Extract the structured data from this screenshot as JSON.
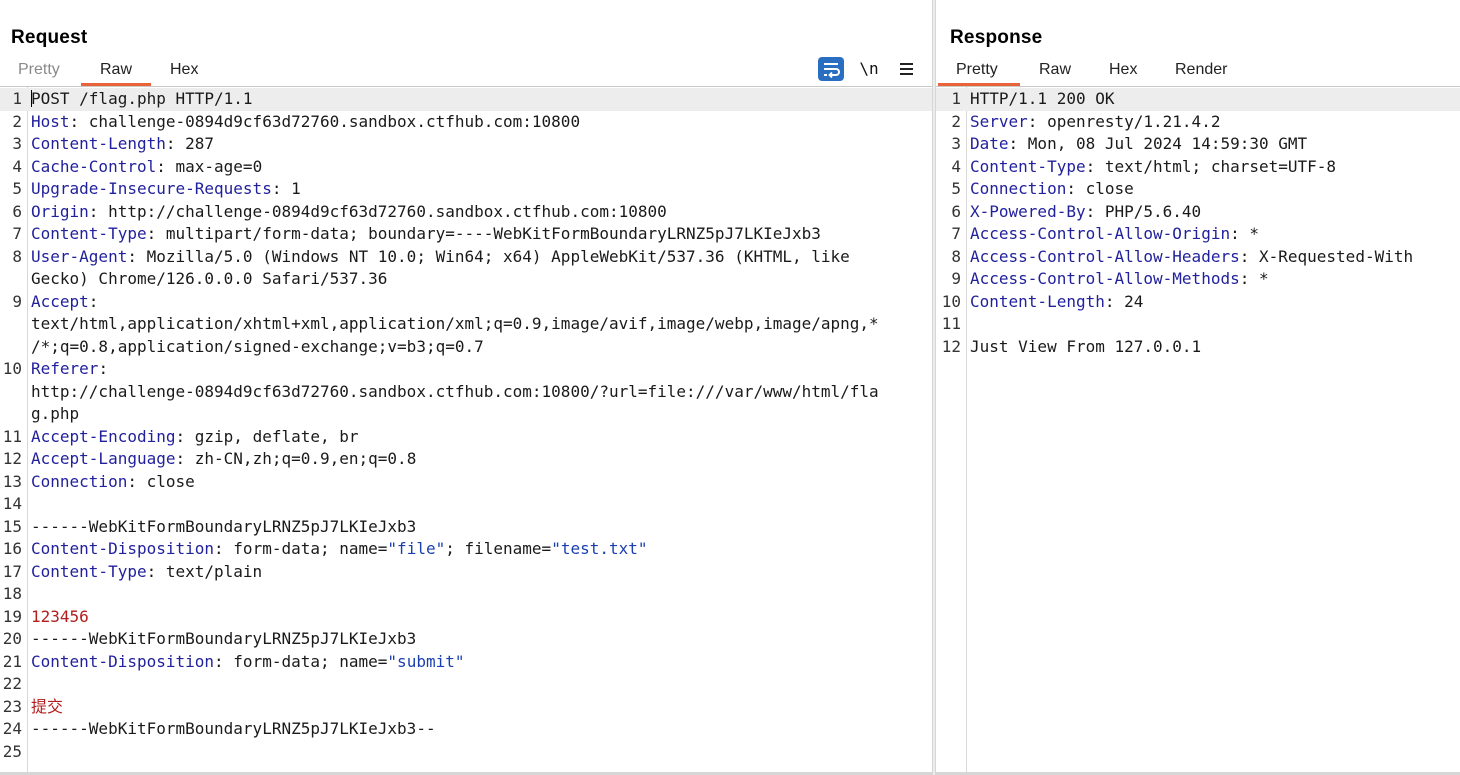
{
  "request": {
    "title": "Request",
    "tabs": [
      {
        "label": "Pretty",
        "disabled": true
      },
      {
        "label": "Raw",
        "active": true
      },
      {
        "label": "Hex"
      }
    ],
    "toolbar": {
      "newline_label": "\\n"
    },
    "lines": [
      {
        "n": "1",
        "segs": [
          {
            "t": "POST /flag.php HTTP/1.1",
            "c": "hval"
          }
        ]
      },
      {
        "n": "2",
        "segs": [
          {
            "t": "Host",
            "c": "hname"
          },
          {
            "t": ": challenge-0894d9cf63d72760.sandbox.ctfhub.com:10800",
            "c": "hval"
          }
        ]
      },
      {
        "n": "3",
        "segs": [
          {
            "t": "Content-Length",
            "c": "hname"
          },
          {
            "t": ": 287",
            "c": "hval"
          }
        ]
      },
      {
        "n": "4",
        "segs": [
          {
            "t": "Cache-Control",
            "c": "hname"
          },
          {
            "t": ": max-age=0",
            "c": "hval"
          }
        ]
      },
      {
        "n": "5",
        "segs": [
          {
            "t": "Upgrade-Insecure-Requests",
            "c": "hname"
          },
          {
            "t": ": 1",
            "c": "hval"
          }
        ]
      },
      {
        "n": "6",
        "segs": [
          {
            "t": "Origin",
            "c": "hname"
          },
          {
            "t": ": http://challenge-0894d9cf63d72760.sandbox.ctfhub.com:10800",
            "c": "hval"
          }
        ]
      },
      {
        "n": "7",
        "segs": [
          {
            "t": "Content-Type",
            "c": "hname"
          },
          {
            "t": ": multipart/form-data; boundary=----WebKitFormBoundaryLRNZ5pJ7LKIeJxb3",
            "c": "hval"
          }
        ]
      },
      {
        "n": "8",
        "segs": [
          {
            "t": "User-Agent",
            "c": "hname"
          },
          {
            "t": ": Mozilla/5.0 (Windows NT 10.0; Win64; x64) AppleWebKit/537.36 (KHTML, like",
            "c": "hval"
          }
        ]
      },
      {
        "n": "",
        "segs": [
          {
            "t": "Gecko) Chrome/126.0.0.0 Safari/537.36",
            "c": "hval"
          }
        ]
      },
      {
        "n": "9",
        "segs": [
          {
            "t": "Accept",
            "c": "hname"
          },
          {
            "t": ":",
            "c": "hval"
          }
        ]
      },
      {
        "n": "",
        "segs": [
          {
            "t": "text/html,application/xhtml+xml,application/xml;q=0.9,image/avif,image/webp,image/apng,*",
            "c": "hval"
          }
        ]
      },
      {
        "n": "",
        "segs": [
          {
            "t": "/*;q=0.8,application/signed-exchange;v=b3;q=0.7",
            "c": "hval"
          }
        ]
      },
      {
        "n": "10",
        "segs": [
          {
            "t": "Referer",
            "c": "hname"
          },
          {
            "t": ":",
            "c": "hval"
          }
        ]
      },
      {
        "n": "",
        "segs": [
          {
            "t": "http://challenge-0894d9cf63d72760.sandbox.ctfhub.com:10800/?url=file:///var/www/html/fla",
            "c": "hval"
          }
        ]
      },
      {
        "n": "",
        "segs": [
          {
            "t": "g.php",
            "c": "hval"
          }
        ]
      },
      {
        "n": "11",
        "segs": [
          {
            "t": "Accept-Encoding",
            "c": "hname"
          },
          {
            "t": ": gzip, deflate, br",
            "c": "hval"
          }
        ]
      },
      {
        "n": "12",
        "segs": [
          {
            "t": "Accept-Language",
            "c": "hname"
          },
          {
            "t": ": zh-CN,zh;q=0.9,en;q=0.8",
            "c": "hval"
          }
        ]
      },
      {
        "n": "13",
        "segs": [
          {
            "t": "Connection",
            "c": "hname"
          },
          {
            "t": ": close",
            "c": "hval"
          }
        ]
      },
      {
        "n": "14",
        "segs": []
      },
      {
        "n": "15",
        "segs": [
          {
            "t": "------WebKitFormBoundaryLRNZ5pJ7LKIeJxb3",
            "c": "hval"
          }
        ]
      },
      {
        "n": "16",
        "segs": [
          {
            "t": "Content-Disposition",
            "c": "hname"
          },
          {
            "t": ": form-data; name=",
            "c": "hval"
          },
          {
            "t": "\"file\"",
            "c": "quoted"
          },
          {
            "t": "; filename=",
            "c": "hval"
          },
          {
            "t": "\"test.txt\"",
            "c": "quoted"
          }
        ]
      },
      {
        "n": "17",
        "segs": [
          {
            "t": "Content-Type",
            "c": "hname"
          },
          {
            "t": ": text/plain",
            "c": "hval"
          }
        ]
      },
      {
        "n": "18",
        "segs": []
      },
      {
        "n": "19",
        "segs": [
          {
            "t": "123456",
            "c": "body-red"
          }
        ]
      },
      {
        "n": "20",
        "segs": [
          {
            "t": "------WebKitFormBoundaryLRNZ5pJ7LKIeJxb3",
            "c": "hval"
          }
        ]
      },
      {
        "n": "21",
        "segs": [
          {
            "t": "Content-Disposition",
            "c": "hname"
          },
          {
            "t": ": form-data; name=",
            "c": "hval"
          },
          {
            "t": "\"submit\"",
            "c": "quoted"
          }
        ]
      },
      {
        "n": "22",
        "segs": []
      },
      {
        "n": "23",
        "segs": [
          {
            "t": "提交",
            "c": "body-red"
          }
        ]
      },
      {
        "n": "24",
        "segs": [
          {
            "t": "------WebKitFormBoundaryLRNZ5pJ7LKIeJxb3--",
            "c": "hval"
          }
        ]
      },
      {
        "n": "25",
        "segs": []
      }
    ]
  },
  "response": {
    "title": "Response",
    "tabs": [
      {
        "label": "Pretty",
        "active": true
      },
      {
        "label": "Raw"
      },
      {
        "label": "Hex"
      },
      {
        "label": "Render"
      }
    ],
    "lines": [
      {
        "n": "1",
        "segs": [
          {
            "t": "HTTP/1.1 200 OK",
            "c": "hval"
          }
        ]
      },
      {
        "n": "2",
        "segs": [
          {
            "t": "Server",
            "c": "hname"
          },
          {
            "t": ": openresty/1.21.4.2",
            "c": "hval"
          }
        ]
      },
      {
        "n": "3",
        "segs": [
          {
            "t": "Date",
            "c": "hname"
          },
          {
            "t": ": Mon, 08 Jul 2024 14:59:30 GMT",
            "c": "hval"
          }
        ]
      },
      {
        "n": "4",
        "segs": [
          {
            "t": "Content-Type",
            "c": "hname"
          },
          {
            "t": ": text/html; charset=UTF-8",
            "c": "hval"
          }
        ]
      },
      {
        "n": "5",
        "segs": [
          {
            "t": "Connection",
            "c": "hname"
          },
          {
            "t": ": close",
            "c": "hval"
          }
        ]
      },
      {
        "n": "6",
        "segs": [
          {
            "t": "X-Powered-By",
            "c": "hname"
          },
          {
            "t": ": PHP/5.6.40",
            "c": "hval"
          }
        ]
      },
      {
        "n": "7",
        "segs": [
          {
            "t": "Access-Control-Allow-Origin",
            "c": "hname"
          },
          {
            "t": ": *",
            "c": "hval"
          }
        ]
      },
      {
        "n": "8",
        "segs": [
          {
            "t": "Access-Control-Allow-Headers",
            "c": "hname"
          },
          {
            "t": ": X-Requested-With",
            "c": "hval"
          }
        ]
      },
      {
        "n": "9",
        "segs": [
          {
            "t": "Access-Control-Allow-Methods",
            "c": "hname"
          },
          {
            "t": ": *",
            "c": "hval"
          }
        ]
      },
      {
        "n": "10",
        "segs": [
          {
            "t": "Content-Length",
            "c": "hname"
          },
          {
            "t": ": 24",
            "c": "hval"
          }
        ]
      },
      {
        "n": "11",
        "segs": []
      },
      {
        "n": "12",
        "segs": [
          {
            "t": "Just View From 127.0.0.1",
            "c": "hval"
          }
        ]
      }
    ]
  },
  "colors": {
    "accent_underline": "#e8623a",
    "header_name": "#22219c",
    "quoted_value": "#1a3fb0",
    "body_text_red": "#b31d1d",
    "wrap_button": "#2a6ec2"
  },
  "icons": [
    "wrap-lines-icon",
    "newline-toggle-icon",
    "hamburger-menu-icon"
  ]
}
